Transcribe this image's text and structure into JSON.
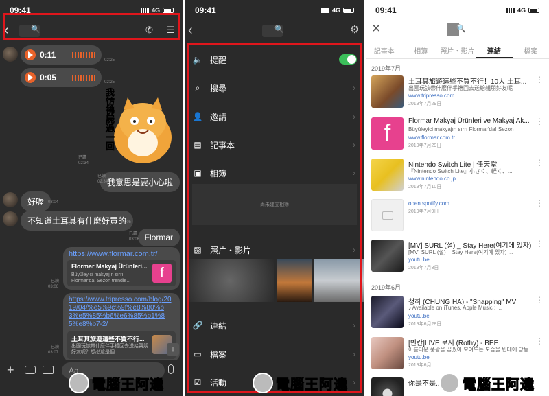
{
  "status": {
    "time": "09:41",
    "network": "4G"
  },
  "chat": {
    "voice_messages": [
      {
        "duration": "0:11",
        "time": "02:25"
      },
      {
        "duration": "0:05",
        "time": "02:25"
      }
    ],
    "sticker_caption": "我彷彿屍過一回",
    "sticker_meta": {
      "read": "已讀",
      "time": "02:34"
    },
    "messages": [
      {
        "text": "我意思是要小心啦",
        "read": "已讀",
        "time": "02:34"
      },
      {
        "text": "好喔",
        "time": "03:04"
      },
      {
        "text": "不知道土耳其有什麼好買的",
        "time": "03:05"
      },
      {
        "text": "Flormar",
        "read": "已讀",
        "time": "03:06"
      }
    ],
    "link_flormar": {
      "url": "https://www.flormar.com.tr/",
      "title": "Flormar Makyaj Ürünleri...",
      "desc": "Büyüleyici makyajın sırrı Flormar'da! Sezon trendle...",
      "read": "已讀",
      "time": "03:06"
    },
    "link_tripresso": {
      "url": "https://www.tripresso.com/blog/2019/04/%e5%9c%9f%e8%80%b3%e5%85%b6%e6%85%b1%85%e8%b7-2/",
      "title": "土耳其旅遊這些不買不行...",
      "desc": "出國玩該帶什麼伴手禮回去送給親朋好友呢？想必這是個...",
      "read": "已讀",
      "time": "03:07"
    },
    "input_placeholder": "Aa"
  },
  "menu": {
    "items": [
      {
        "label": "提醒",
        "icon": "speaker-icon"
      },
      {
        "label": "搜尋",
        "icon": "search-icon"
      },
      {
        "label": "邀請",
        "icon": "add-user-icon"
      },
      {
        "label": "記事本",
        "icon": "notebook-icon"
      },
      {
        "label": "相簿",
        "icon": "album-icon"
      },
      {
        "label": "照片・影片",
        "icon": "photo-icon"
      },
      {
        "label": "連結",
        "icon": "link-icon"
      },
      {
        "label": "檔案",
        "icon": "folder-icon"
      },
      {
        "label": "活動",
        "icon": "calendar-icon"
      }
    ],
    "album_empty": "尚未建立相簿",
    "notification_on": true
  },
  "links": {
    "tabs": [
      "記事本",
      "相簿",
      "照片・影片",
      "連結",
      "檔案"
    ],
    "active_tab": "連結",
    "groups": [
      {
        "month": "2019年7月",
        "items": [
          {
            "title": "土耳其旅遊這些不買不行！10大 土耳...",
            "sub": "出國玩該帶什麼伴手禮回去送給親朋好友呢",
            "url": "www.tripresso.com",
            "date": "2019年7月29日",
            "thumb": "photo"
          },
          {
            "title": "Flormar Makyaj Ürünleri ve Makyaj Ak...",
            "sub": "Büyüleyici makyajın sırrı Flormar'da! Sezon",
            "url": "www.flormar.com.tr",
            "date": "2019年7月29日",
            "thumb": "flormar"
          },
          {
            "title": "Nintendo Switch Lite | 任天堂",
            "sub": "『Nintendo Switch Lite』小さく、軽く、...",
            "url": "www.nintendo.co.jp",
            "date": "2019年7月10日",
            "thumb": "switch"
          },
          {
            "title": "",
            "sub": "",
            "url": "open.spotify.com",
            "date": "2019年7月9日",
            "thumb": "placeholder"
          },
          {
            "title": "[MV] SURL (설) _ Stay Here(여기에 있자)",
            "sub": "[MV] SURL (설) _ Stay Here(여기에 있자) ...",
            "url": "youtu.be",
            "date": "2019年7月3日",
            "thumb": "video1"
          }
        ]
      },
      {
        "month": "2019年6月",
        "items": [
          {
            "title": "청하 (CHUNG HA) - \"Snapping\" MV",
            "sub": "♪ Available on iTunes, Apple Music : ...",
            "url": "youtu.be",
            "date": "2019年6月28日",
            "thumb": "video2"
          },
          {
            "title": "[빈칸]LIVE 로시 (Rothy) - BEE",
            "sub": "아름다운 풍광을 꿈꿨이 모여드는 모습을 빈데에 당등...",
            "url": "youtu.be",
            "date": "2019年6月...",
            "thumb": "video3"
          },
          {
            "title": "你是不是...",
            "sub": "",
            "url": "",
            "date": "",
            "thumb": "disc"
          }
        ]
      }
    ]
  },
  "watermark": {
    "text": "電腦王阿達",
    "url": "http://www.kocpc.com.tw"
  },
  "colors": {
    "accent_green": "#3bbf5a",
    "highlight": "#e0161c",
    "voice_orange": "#e8622a",
    "link_blue": "#3a6cc0"
  }
}
